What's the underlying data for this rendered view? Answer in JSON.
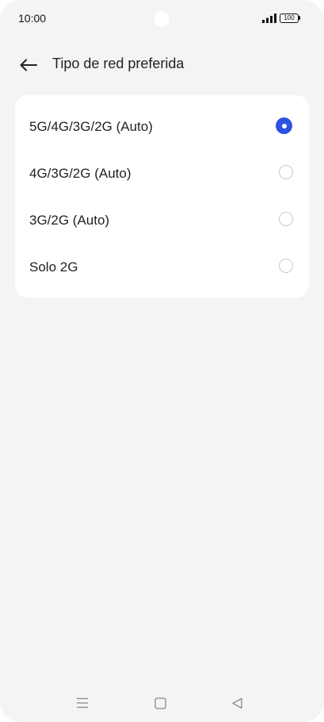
{
  "status_bar": {
    "time": "10:00",
    "battery": "100",
    "icons": [
      "signal-icon",
      "battery-icon"
    ]
  },
  "header": {
    "back_icon": "arrow-left-icon",
    "title": "Tipo de red preferida"
  },
  "options": [
    {
      "label": "5G/4G/3G/2G (Auto)",
      "selected": true
    },
    {
      "label": "4G/3G/2G (Auto)",
      "selected": false
    },
    {
      "label": "3G/2G (Auto)",
      "selected": false
    },
    {
      "label": "Solo 2G",
      "selected": false
    }
  ],
  "nav_bar": {
    "icons": [
      "menu-icon",
      "home-icon",
      "back-triangle-icon"
    ]
  },
  "colors": {
    "accent": "#2c53e0",
    "background": "#f4f4f4",
    "card": "#ffffff"
  }
}
